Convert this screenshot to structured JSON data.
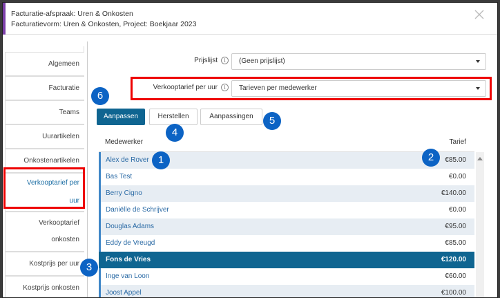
{
  "header": {
    "line1": "Facturatie-afspraak: Uren & Onkosten",
    "line2": "Facturatievorm: Uren & Onkosten, Project: Boekjaar 2023",
    "accent_color": "#7b3fa8"
  },
  "sidebar": {
    "items": [
      {
        "label": "Algemeen"
      },
      {
        "label": "Facturatie"
      },
      {
        "label": "Teams"
      },
      {
        "label": "Uurartikelen"
      },
      {
        "label": "Onkostenartikelen"
      },
      {
        "label_line1": "Verkooptarief per",
        "label_line2": "uur"
      },
      {
        "label_line1": "Verkooptarief",
        "label_line2": "onkosten"
      },
      {
        "label": "Kostprijs per uur"
      },
      {
        "label": "Kostprijs onkosten"
      }
    ]
  },
  "form": {
    "pricelist_label": "Prijslijst",
    "pricelist_value": "(Geen prijslijst)",
    "rate_label": "Verkooptarief per uur",
    "rate_value": "Tarieven per medewerker"
  },
  "buttons": {
    "adjust": "Aanpassen",
    "restore": "Herstellen",
    "changes": "Aanpassingen"
  },
  "table": {
    "col_employee": "Medewerker",
    "col_rate": "Tarief",
    "rows": [
      {
        "name": "Alex de Rover",
        "rate": "€85.00"
      },
      {
        "name": "Bas Test",
        "rate": "€0.00"
      },
      {
        "name": "Berry Cigno",
        "rate": "€140.00"
      },
      {
        "name": "Daniëlle de Schrijver",
        "rate": "€0.00"
      },
      {
        "name": "Douglas Adams",
        "rate": "€95.00"
      },
      {
        "name": "Eddy de Vreugd",
        "rate": "€85.00"
      },
      {
        "name": "Fons de Vries",
        "rate": "€120.00",
        "selected": true
      },
      {
        "name": "Inge van Loon",
        "rate": "€60.00"
      },
      {
        "name": "Joost Appel",
        "rate": "€100.00"
      }
    ]
  },
  "badges": [
    "1",
    "2",
    "3",
    "4",
    "5",
    "6"
  ],
  "colors": {
    "primary": "#0f6591",
    "highlight": "#e00000",
    "badge": "#0c63c4"
  }
}
